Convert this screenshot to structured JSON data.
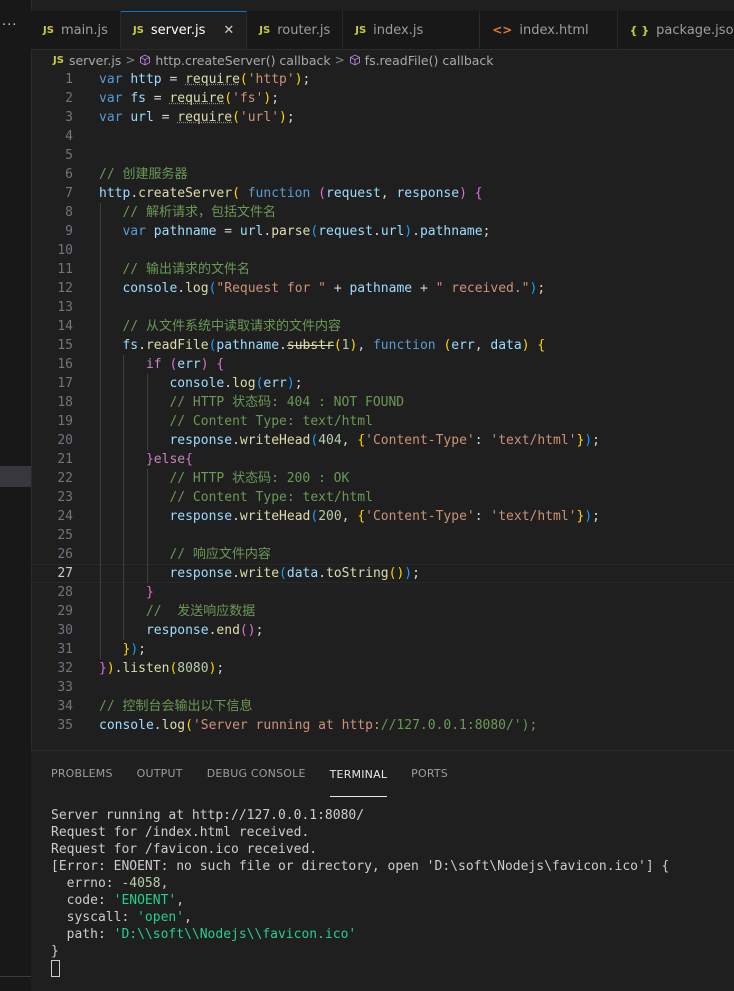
{
  "sidebar": {
    "more_label": "..."
  },
  "tabs": [
    {
      "icon": "JS",
      "label": "main.js",
      "active": false
    },
    {
      "icon": "JS",
      "label": "server.js",
      "active": true,
      "close": "✕"
    },
    {
      "icon": "JS",
      "label": "router.js",
      "active": false
    },
    {
      "icon": "JS",
      "label": "index.js",
      "active": false
    },
    {
      "icon": "<>",
      "label": "index.html",
      "active": false
    },
    {
      "icon": "{ }",
      "label": "package.json",
      "active": false
    }
  ],
  "breadcrumb": {
    "file_icon": "JS",
    "file": "server.js",
    "items": [
      "http.createServer() callback",
      "fs.readFile() callback"
    ],
    "separator": ">"
  },
  "editor": {
    "line_numbers": [
      "1",
      "2",
      "3",
      "4",
      "5",
      "6",
      "7",
      "8",
      "9",
      "10",
      "11",
      "12",
      "13",
      "14",
      "15",
      "16",
      "17",
      "18",
      "19",
      "20",
      "21",
      "22",
      "23",
      "24",
      "25",
      "26",
      "27",
      "28",
      "29",
      "30",
      "31",
      "32",
      "33",
      "34",
      "35"
    ],
    "current_line": 27,
    "lines": [
      "var http = require('http');",
      "var fs = require('fs');",
      "var url = require('url');",
      "",
      "",
      "// 创建服务器",
      "http.createServer( function (request, response) {",
      "   // 解析请求，包括文件名",
      "   var pathname = url.parse(request.url).pathname;",
      "",
      "   // 输出请求的文件名",
      "   console.log(\"Request for \" + pathname + \" received.\");",
      "",
      "   // 从文件系统中读取请求的文件内容",
      "   fs.readFile(pathname.substr(1), function (err, data) {",
      "      if (err) {",
      "         console.log(err);",
      "         // HTTP 状态码: 404 : NOT FOUND",
      "         // Content Type: text/html",
      "         response.writeHead(404, {'Content-Type': 'text/html'});",
      "      }else{",
      "         // HTTP 状态码: 200 : OK",
      "         // Content Type: text/html",
      "         response.writeHead(200, {'Content-Type': 'text/html'});",
      "",
      "         // 响应文件内容",
      "         response.write(data.toString());",
      "      }",
      "      //  发送响应数据",
      "      response.end();",
      "   });",
      "}).listen(8080);",
      "",
      "// 控制台会输出以下信息",
      "console.log('Server running at http://127.0.0.1:8080/');"
    ]
  },
  "panel": {
    "tabs": [
      "PROBLEMS",
      "OUTPUT",
      "DEBUG CONSOLE",
      "TERMINAL",
      "PORTS"
    ],
    "active_tab": "TERMINAL",
    "terminal_lines": [
      "Server running at http://127.0.0.1:8080/",
      "Request for /index.html received.",
      "Request for /favicon.ico received.",
      "[Error: ENOENT: no such file or directory, open 'D:\\soft\\Nodejs\\favicon.ico'] {",
      "  errno: -4058,",
      "  code: 'ENOENT',",
      "  syscall: 'open',",
      "  path: 'D:\\\\soft\\\\Nodejs\\\\favicon.ico'",
      "}"
    ]
  },
  "colors": {
    "background": "#1f1f1f",
    "keyword": "#569cd6",
    "string": "#ce9178",
    "comment": "#6a9955",
    "function": "#dcdcaa",
    "variable": "#9cdcfe",
    "terminal_string": "#23d18b"
  }
}
